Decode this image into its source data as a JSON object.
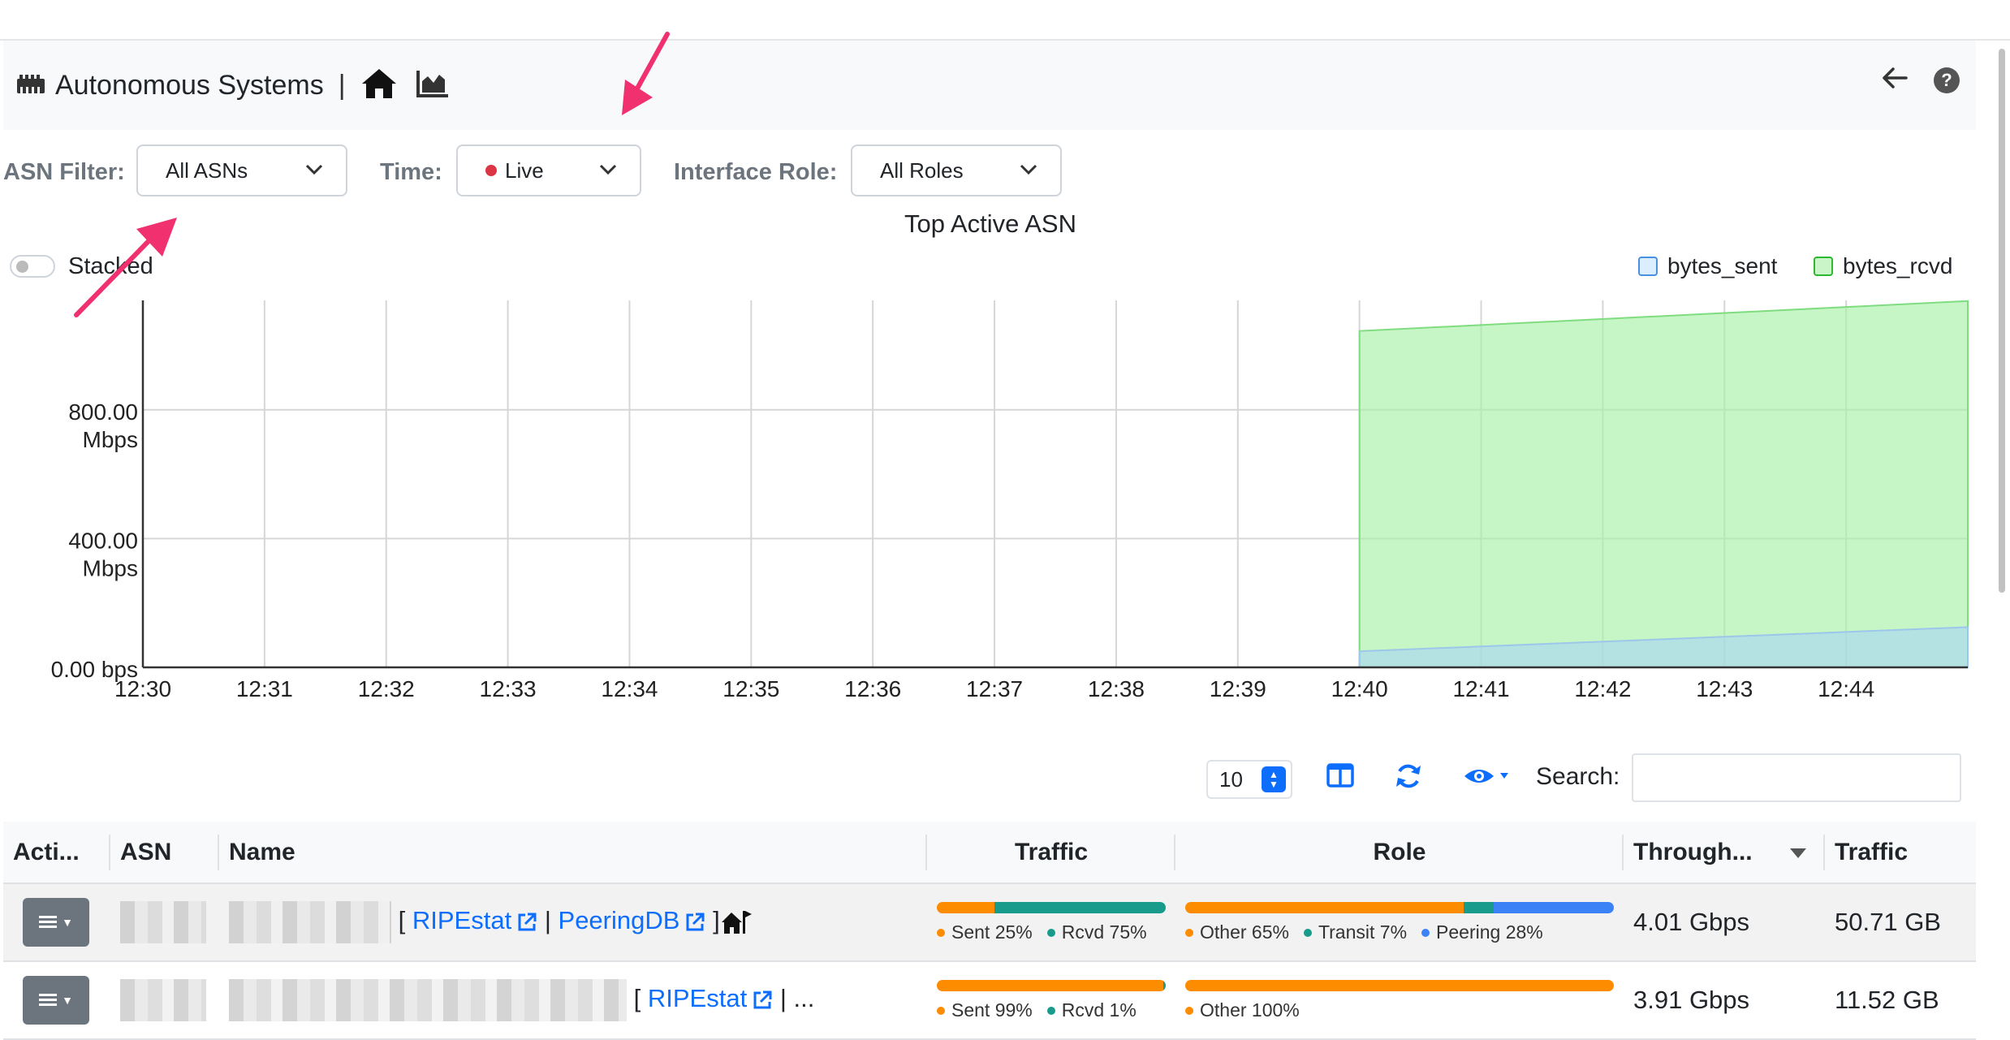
{
  "header": {
    "title": "Autonomous Systems",
    "separator": "|"
  },
  "filters": {
    "asn_label": "ASN Filter:",
    "asn_value": "All ASNs",
    "time_label": "Time:",
    "time_value": "Live",
    "role_label": "Interface Role:",
    "role_value": "All Roles"
  },
  "chart_toggle": {
    "label": "Stacked",
    "checked": false
  },
  "chart_data": {
    "type": "area",
    "title": "Top Active ASN",
    "x_ticks": [
      "12:30",
      "12:31",
      "12:32",
      "12:33",
      "12:34",
      "12:35",
      "12:36",
      "12:37",
      "12:38",
      "12:39",
      "12:40",
      "12:41",
      "12:42",
      "12:43",
      "12:44"
    ],
    "y_ticks": [
      {
        "value": 0,
        "line1": "0.00 bps",
        "line2": ""
      },
      {
        "value": 400,
        "line1": "400.00",
        "line2": "Mbps"
      },
      {
        "value": 800,
        "line1": "800.00",
        "line2": "Mbps"
      }
    ],
    "y_unit": "Mbps",
    "ylim": [
      0,
      1140
    ],
    "xlim_minutes": [
      0,
      15
    ],
    "series": [
      {
        "name": "bytes_sent",
        "color": "#a9d4f5",
        "x": [
          10.0,
          15.0
        ],
        "y": [
          50,
          125
        ]
      },
      {
        "name": "bytes_rcvd",
        "color": "#a8f0a8",
        "x": [
          10.0,
          15.0
        ],
        "y": [
          1045,
          1138
        ]
      }
    ],
    "legend_position": "top-right",
    "grid": true
  },
  "table_controls": {
    "page_length": "10",
    "search_label": "Search:",
    "search_value": ""
  },
  "table": {
    "columns": [
      "Acti...",
      "ASN",
      "Name",
      "Traffic",
      "Role",
      "Through...",
      "Traffic"
    ],
    "rows": [
      {
        "links": [
          "RIPEstat",
          "PeeringDB"
        ],
        "open": "[",
        "mid": "|",
        "close": "]",
        "traffic_bar": [
          {
            "label": "Sent 25%",
            "pct": 25,
            "color": "#fd8c00"
          },
          {
            "label": "Rcvd 75%",
            "pct": 75,
            "color": "#189b8a"
          }
        ],
        "role_bar": [
          {
            "label": "Other 65%",
            "pct": 65,
            "color": "#fd8c00"
          },
          {
            "label": "Transit 7%",
            "pct": 7,
            "color": "#189b8a"
          },
          {
            "label": "Peering 28%",
            "pct": 28,
            "color": "#3b82f6"
          }
        ],
        "throughput": "4.01 Gbps",
        "traffic": "50.71 GB"
      },
      {
        "links": [
          "RIPEstat"
        ],
        "open": "[",
        "mid": "|",
        "close": "...",
        "traffic_bar": [
          {
            "label": "Sent 99%",
            "pct": 99,
            "color": "#fd8c00"
          },
          {
            "label": "Rcvd 1%",
            "pct": 1,
            "color": "#189b8a"
          }
        ],
        "role_bar": [
          {
            "label": "Other 100%",
            "pct": 100,
            "color": "#fd8c00"
          }
        ],
        "throughput": "3.91 Gbps",
        "traffic": "11.52 GB"
      }
    ]
  }
}
